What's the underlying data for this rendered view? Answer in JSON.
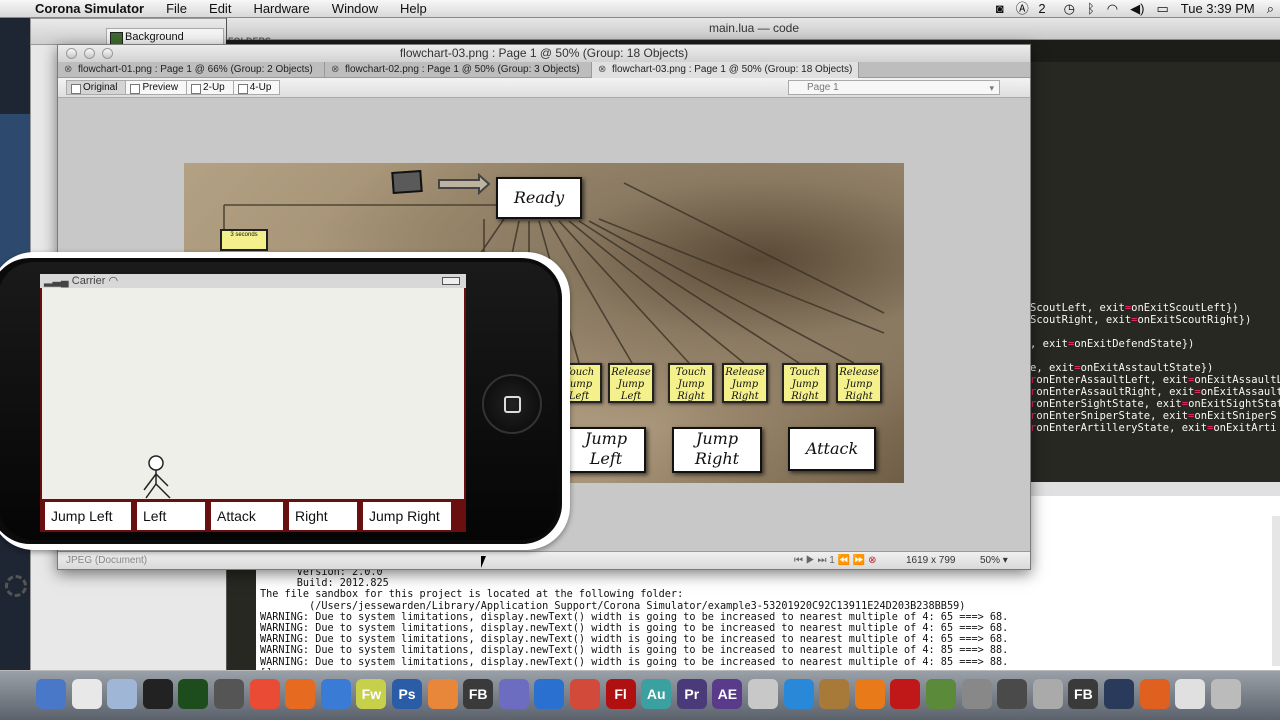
{
  "menubar": {
    "app": "Corona Simulator",
    "items": [
      "File",
      "Edit",
      "Hardware",
      "Window",
      "Help"
    ],
    "status_count": "2",
    "clock": "Tue 3:39 PM"
  },
  "background_window": {
    "tab": "Background",
    "folders_label": "FOLDERS"
  },
  "code_window": {
    "title": "main.lua — code",
    "lines": [
      [
        "ScoutLeft, exit",
        "=",
        "onExitScoutLeft})"
      ],
      [
        "ScoutRight, exit",
        "=",
        "onExitScoutRight})"
      ],
      [
        "",
        "",
        ""
      ],
      [
        ", exit",
        "=",
        "onExitDefendState})"
      ],
      [
        "",
        "",
        ""
      ],
      [
        "e, exit",
        "=",
        "onExitAsstaultState})"
      ],
      [
        "onEnterAssaultLeft, exit",
        "=",
        "onExitAssaultLef"
      ],
      [
        "onEnterAssaultRight, exit",
        "=",
        "onExitAssaultRi"
      ],
      [
        "onEnterSightState, exit",
        "=",
        "onExitSightStat"
      ],
      [
        "onEnterSniperState, exit",
        "=",
        "onExitSniperS"
      ],
      [
        "onEnterArtilleryState, exit",
        "=",
        "onExitArti"
      ]
    ],
    "line_prefix": [
      "",
      "",
      "",
      "",
      "",
      "",
      "r",
      "r",
      "r",
      "r",
      "r"
    ]
  },
  "console": {
    "lines": [
      "      Version: 2.0.0",
      "      Build: 2012.825",
      "The file sandbox for this project is located at the following folder:",
      "        (/Users/jessewarden/Library/Application Support/Corona Simulator/example3-53201920C92C13911E24D203B238BB59)",
      "WARNING: Due to system limitations, display.newText() width is going to be increased to nearest multiple of 4: 65 ===> 68.",
      "WARNING: Due to system limitations, display.newText() width is going to be increased to nearest multiple of 4: 65 ===> 68.",
      "WARNING: Due to system limitations, display.newText() width is going to be increased to nearest multiple of 4: 65 ===> 68.",
      "WARNING: Due to system limitations, display.newText() width is going to be increased to nearest multiple of 4: 85 ===> 88.",
      "WARNING: Due to system limitations, display.newText() width is going to be increased to nearest multiple of 4: 85 ===> 88.",
      "[]"
    ]
  },
  "preview": {
    "title": "flowchart-03.png : Page 1 @ 50% (Group: 18 Objects)",
    "tabs": [
      {
        "label": "flowchart-01.png : Page 1 @ 66% (Group: 2 Objects)",
        "active": false
      },
      {
        "label": "flowchart-02.png : Page 1 @ 50% (Group: 3 Objects)",
        "active": false
      },
      {
        "label": "flowchart-03.png : Page 1 @ 50% (Group: 18 Objects)",
        "active": true
      }
    ],
    "close_glyph": "⊗",
    "modes": [
      "Original",
      "Preview",
      "2-Up",
      "4-Up"
    ],
    "selected_mode": "Original",
    "page_select": "Page 1",
    "status": {
      "doc_type": "JPEG (Document)",
      "page": "1",
      "dimensions": "1619 x 799",
      "zoom": "50%"
    }
  },
  "flowchart": {
    "ready": "Ready",
    "timer_note": "3 seconds",
    "stickies": [
      [
        "Touch",
        "Jump",
        "Left"
      ],
      [
        "Release",
        "Jump",
        "Left"
      ],
      [
        "Touch",
        "Jump",
        "Right"
      ],
      [
        "Release",
        "Jump",
        "Right"
      ],
      [
        "Touch",
        "Jump",
        "Right"
      ],
      [
        "Release",
        "Jump",
        "Right"
      ]
    ],
    "states": [
      [
        "Jump",
        "Left"
      ],
      [
        "Jump",
        "Right"
      ],
      [
        "Attack"
      ]
    ]
  },
  "simulator": {
    "carrier": "Carrier",
    "buttons": [
      "Jump Left",
      "Left",
      "Attack",
      "Right",
      "Jump Right"
    ]
  },
  "dock": {
    "apps": [
      "finder-icon",
      "textedit-icon",
      "preview-icon",
      "terminal-icon",
      "activity-monitor-icon",
      "dashboard-icon",
      "chrome-icon",
      "firefox-icon",
      "safari-icon",
      "fireworks-icon",
      "photoshop-icon",
      "sublime-text-icon",
      "flash-builder-icon",
      "browser-icon",
      "jetbrains-icon",
      "reload-icon",
      "flash-icon",
      "audition-icon",
      "premiere-icon",
      "after-effects-icon",
      "bird-icon",
      "facetime-icon",
      "game-icon",
      "vlc-icon",
      "presenter-icon",
      "minecraft-icon",
      "projector-icon",
      "corona-icon",
      "utility-icon",
      "flash-builder-2-icon",
      "clapper-icon",
      "lifebuoy-icon",
      "document-icon",
      "trash-icon"
    ],
    "label_fw": "Fw",
    "label_ps": "Ps",
    "label_fb": "FB",
    "label_fl": "Fl",
    "label_au": "Au",
    "label_pr": "Pr",
    "label_ae": "AE",
    "label_fb2": "FB"
  },
  "colors": {
    "accent_dark_red": "#6a0f0f",
    "sticky_yellow": "#f4f08c",
    "code_bg": "#272822",
    "keyword_pink": "#f92672"
  }
}
